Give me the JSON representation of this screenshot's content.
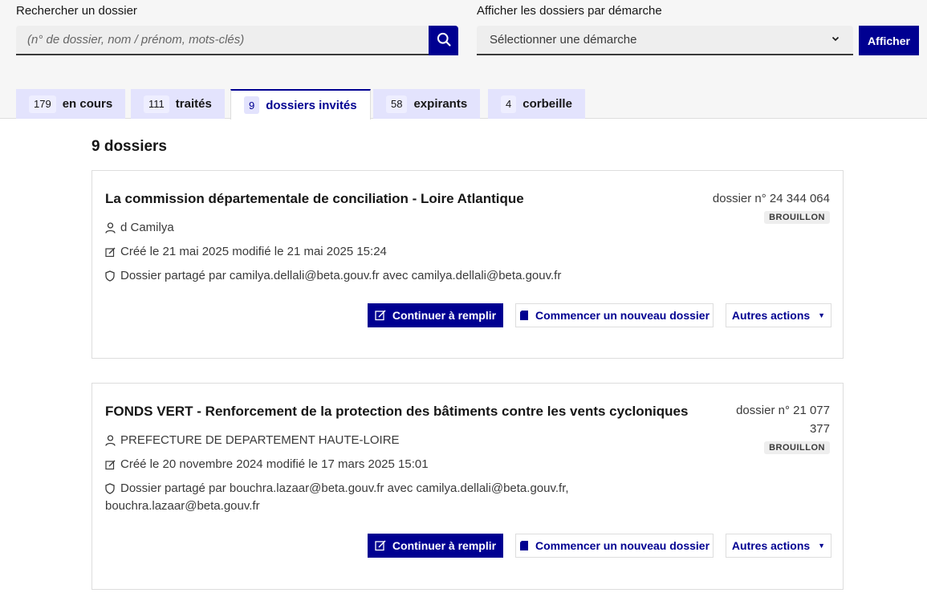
{
  "search": {
    "label": "Rechercher un dossier",
    "placeholder": "(n° de dossier, nom / prénom, mots-clés)"
  },
  "filter": {
    "label": "Afficher les dossiers par démarche",
    "select_value": "Sélectionner une démarche",
    "button": "Afficher"
  },
  "tabs": [
    {
      "count": "179",
      "label": "en cours"
    },
    {
      "count": "111",
      "label": "traités"
    },
    {
      "count": "9",
      "label": "dossiers invités"
    },
    {
      "count": "58",
      "label": "expirants"
    },
    {
      "count": "4",
      "label": "corbeille"
    }
  ],
  "active_tab": "dossiers invités",
  "list": {
    "count_label": "9 dossiers",
    "cards": [
      {
        "title": "La commission départementale de conciliation - Loire Atlantique",
        "number": "dossier n° 24 344 064",
        "status": "BROUILLON",
        "user": "d Camilya",
        "dates": "Créé le 21 mai 2025 modifié le 21 mai 2025 15:24",
        "shared_line1": "Dossier partagé par camilya.dellali@beta.gouv.fr avec camilya.dellali@beta.gouv.fr",
        "shared_line2": ""
      },
      {
        "title": "FONDS VERT - Renforcement de la protection des bâtiments contre les vents cycloniques",
        "number_line1": "dossier n° 21 077",
        "number_line2": "377",
        "status": "BROUILLON",
        "user": "PREFECTURE DE DEPARTEMENT HAUTE-LOIRE",
        "dates": "Créé le 20 novembre 2024 modifié le 17 mars 2025 15:01",
        "shared_line1": "Dossier partagé par bouchra.lazaar@beta.gouv.fr avec camilya.dellali@beta.gouv.fr,",
        "shared_line2": "bouchra.lazaar@beta.gouv.fr"
      }
    ]
  },
  "actions": {
    "continue": "Continuer à remplir",
    "new": "Commencer un nouveau dossier",
    "more": "Autres actions"
  },
  "icons": {
    "search": "search-icon",
    "select": "chevron-down-icon",
    "user": "user-icon",
    "dates": "edit-icon",
    "shared": "shield-icon",
    "continue": "edit-pen-icon",
    "new": "file-add-icon",
    "more": "caret-down-icon"
  },
  "colors": {
    "primary": "#000091",
    "tab_bg": "#e3e3fd",
    "badge_bg": "#eeeeee",
    "border": "#dddddd"
  }
}
